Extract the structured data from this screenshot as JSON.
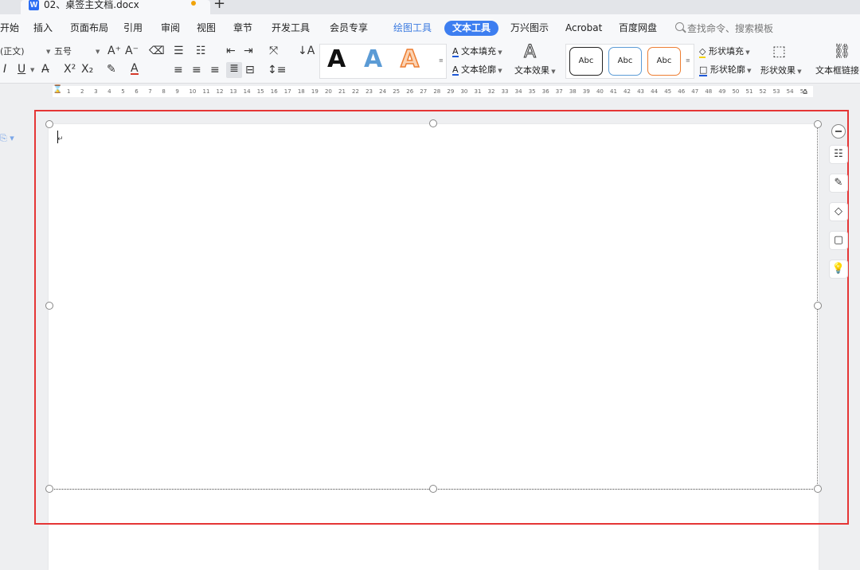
{
  "tabbar": {
    "doc_title": "02、桌签主文档.docx",
    "logo_letter": "W",
    "new_tab": "+"
  },
  "menu": {
    "items": [
      "开始",
      "插入",
      "页面布局",
      "引用",
      "审阅",
      "视图",
      "章节",
      "开发工具",
      "会员专享",
      "绘图工具",
      "文本工具",
      "万兴图示",
      "Acrobat",
      "百度网盘"
    ],
    "search_placeholder": "查找命令、搜索模板"
  },
  "toolbar": {
    "font_name": "(正文)",
    "font_size": "五号",
    "styles": {
      "a1": "A",
      "a2": "A",
      "a3": "A"
    },
    "text_fill": "文本填充",
    "text_outline": "文本轮廓",
    "text_effect": "文本效果",
    "shape_sample": "Abc",
    "shape_fill": "形状填充",
    "shape_outline": "形状轮廓",
    "shape_effect": "形状效果",
    "textbox_link": "文本框链接"
  },
  "ruler": {
    "ticks": [
      "1",
      "2",
      "3",
      "4",
      "5",
      "6",
      "7",
      "8",
      "9",
      "10",
      "11",
      "12",
      "13",
      "14",
      "15",
      "16",
      "17",
      "18",
      "19",
      "20",
      "21",
      "22",
      "23",
      "24",
      "25",
      "26",
      "27",
      "28",
      "29",
      "30",
      "31",
      "32",
      "33",
      "34",
      "35",
      "36",
      "37",
      "38",
      "39",
      "40",
      "41",
      "42",
      "43",
      "44",
      "45",
      "46",
      "47",
      "48",
      "49",
      "50",
      "51",
      "52",
      "53",
      "54",
      "55"
    ]
  },
  "colors": {
    "accent": "#3d7ef0",
    "highlight": "#e53535",
    "unsaved": "#f0a30a"
  }
}
